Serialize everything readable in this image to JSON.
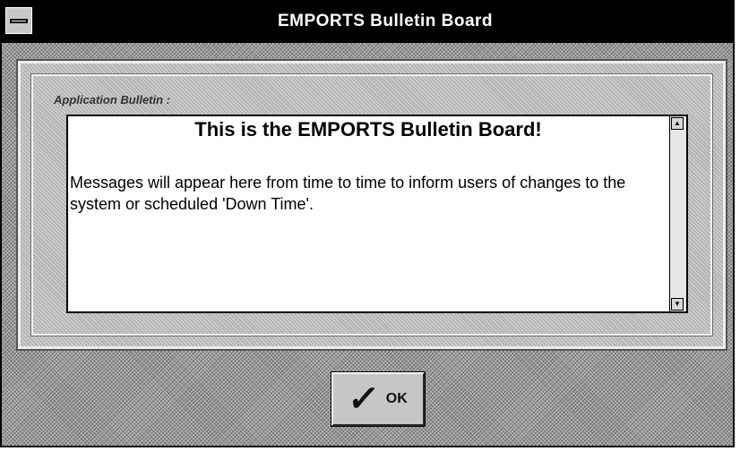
{
  "window": {
    "title": "EMPORTS Bulletin Board"
  },
  "bulletin": {
    "label": "Application Bulletin :",
    "heading": "This is the EMPORTS Bulletin Board!",
    "message": "Messages will appear here from time to time to inform users of changes to the system or scheduled 'Down Time'."
  },
  "actions": {
    "ok_label": "OK"
  },
  "icons": {
    "system_menu": "system-menu-icon",
    "scroll_up": "scroll-up-arrow-icon",
    "scroll_down": "scroll-down-arrow-icon",
    "ok": "checkmark-icon"
  }
}
